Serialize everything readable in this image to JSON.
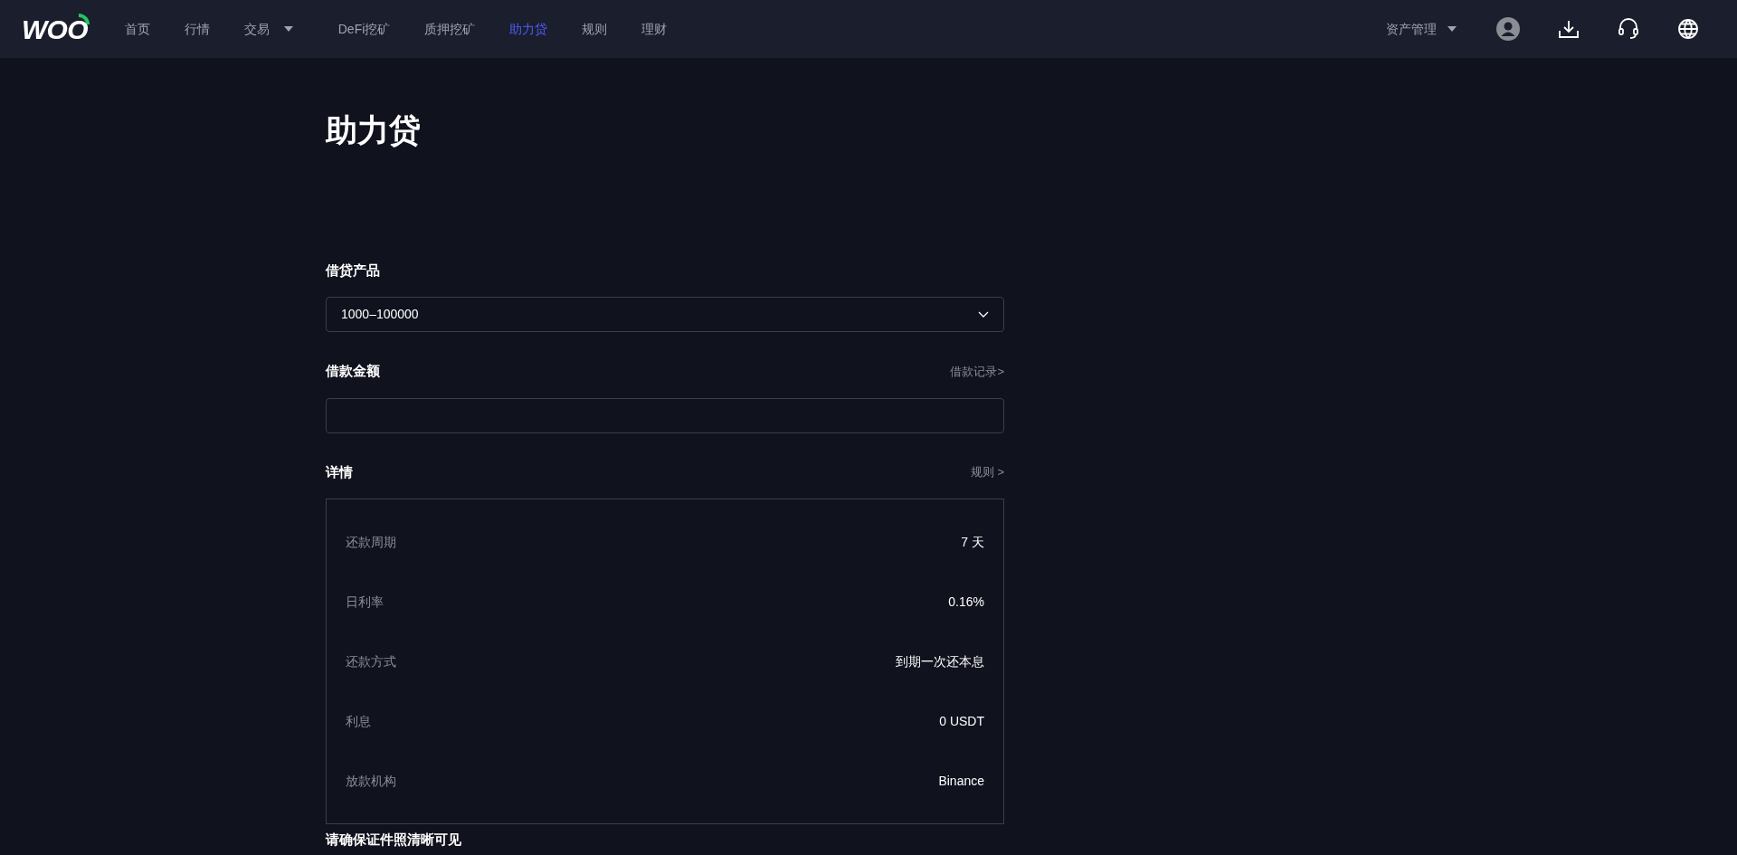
{
  "header": {
    "logo": "WOO",
    "nav": [
      {
        "label": "首页",
        "selected": false,
        "dropdown": false
      },
      {
        "label": "行情",
        "selected": false,
        "dropdown": false
      },
      {
        "label": "交易",
        "selected": false,
        "dropdown": true
      },
      {
        "label": "DeFi挖矿",
        "selected": false,
        "dropdown": false
      },
      {
        "label": "质押挖矿",
        "selected": false,
        "dropdown": false
      },
      {
        "label": "助力贷",
        "selected": true,
        "dropdown": false
      },
      {
        "label": "规则",
        "selected": false,
        "dropdown": false
      },
      {
        "label": "理财",
        "selected": false,
        "dropdown": false
      }
    ],
    "asset_menu": "资产管理"
  },
  "page": {
    "title": "助力贷",
    "product": {
      "label": "借贷产品",
      "value": "1000–100000"
    },
    "amount": {
      "label": "借款金额",
      "link": "借款记录>"
    },
    "details": {
      "label": "详情",
      "link": "规则 >",
      "rows": [
        {
          "label": "还款周期",
          "value": "7 天"
        },
        {
          "label": "日利率",
          "value": "0.16%"
        },
        {
          "label": "还款方式",
          "value": "到期一次还本息"
        },
        {
          "label": "利息",
          "value": "0 USDT"
        },
        {
          "label": "放款机构",
          "value": "Binance"
        }
      ]
    },
    "footer_note": "请确保证件照清晰可见"
  }
}
